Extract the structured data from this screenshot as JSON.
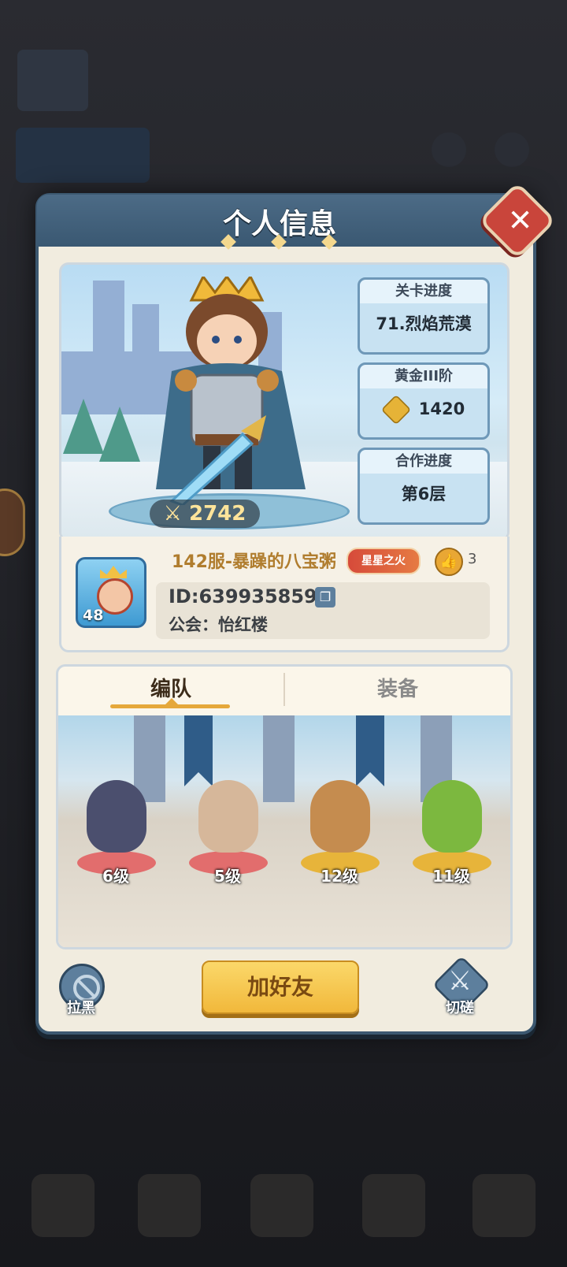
{
  "modal": {
    "title": "个人信息",
    "close_label": "✕"
  },
  "hero": {
    "power": "2742",
    "stats": [
      {
        "label": "关卡进度",
        "value": "71.烈焰荒漠"
      },
      {
        "label": "黄金III阶",
        "value": "1420"
      },
      {
        "label": "合作进度",
        "value": "第6层"
      }
    ]
  },
  "player": {
    "level": "48",
    "name": "142服-暴躁的八宝粥",
    "title_badge": "星星之火",
    "likes": "3",
    "id": "ID:639935859",
    "guild": "公会：怡红楼"
  },
  "tabs": [
    {
      "label": "编队",
      "active": true
    },
    {
      "label": "装备",
      "active": false
    }
  ],
  "team": [
    {
      "level": "6级",
      "ring_color": "#e26d6d",
      "body_color": "#4b4f6e"
    },
    {
      "level": "5级",
      "ring_color": "#e26d6d",
      "body_color": "#d6b79a"
    },
    {
      "level": "12级",
      "ring_color": "#e7b43a",
      "body_color": "#c58c4f"
    },
    {
      "level": "11级",
      "ring_color": "#e7b43a",
      "body_color": "#7cb83f"
    }
  ],
  "actions": {
    "block": "拉黑",
    "add_friend": "加好友",
    "spar": "切磋"
  }
}
